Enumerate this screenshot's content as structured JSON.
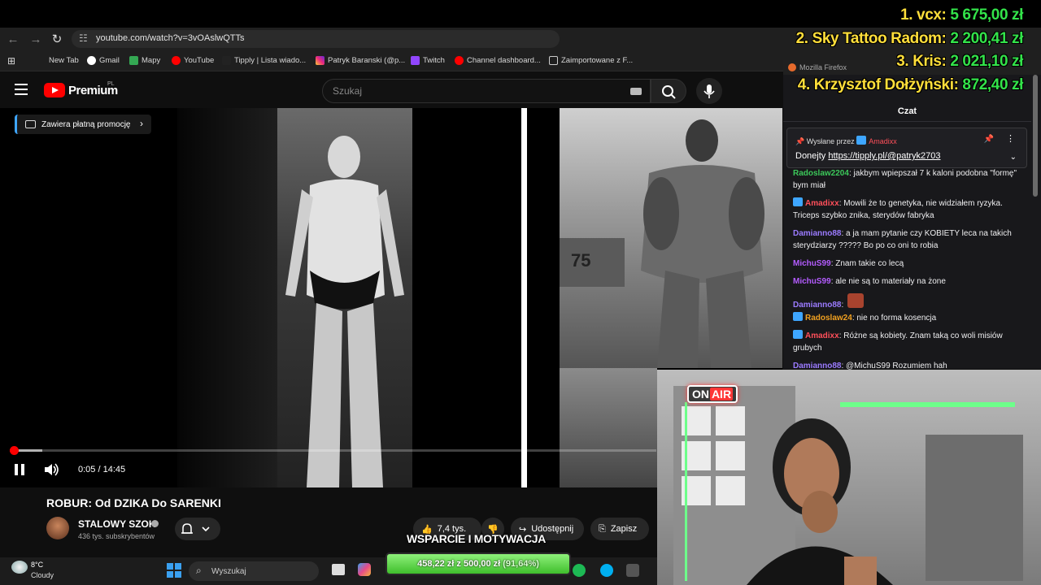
{
  "browser": {
    "url": "youtube.com/watch?v=3vOAslwQTTs",
    "bookmarks": [
      "New Tab",
      "Gmail",
      "Mapy",
      "YouTube",
      "Tipply | Lista wiado...",
      "Patryk Baranski (@p...",
      "Twitch",
      "Channel dashboard...",
      "Zaimportowane z F..."
    ]
  },
  "youtube": {
    "logo_text": "Premium",
    "region": "PL",
    "search_placeholder": "Szukaj",
    "promo_label": "Zawiera płatną promocję",
    "time_display": "0:05 / 14:45",
    "progress_fraction": 0.006,
    "buffered_fraction": 0.05,
    "video_title": "ROBUR: Od DZIKA Do SARENKI",
    "channel_name": "STALOWY SZOK",
    "channel_subs": "436 tys. subskrybentów",
    "likes": "7,4 tys.",
    "share_label": "Udostępnij",
    "save_label": "Zapisz"
  },
  "leaderboard": [
    {
      "rank": "1.",
      "name": "vcx:",
      "amount": "5 675,00 zł"
    },
    {
      "rank": "2.",
      "name": "Sky Tattoo Radom:",
      "amount": "2 200,41 zł"
    },
    {
      "rank": "3.",
      "name": "Kris:",
      "amount": "2 021,10 zł"
    },
    {
      "rank": "4.",
      "name": "Krzysztof Dołżyński:",
      "amount": "872,40 zł"
    }
  ],
  "chat": {
    "window_title": "Mozilla Firefox",
    "header": "Czat",
    "pinned_by_label": "Wysłane przez",
    "pinned_user": "Amadixx",
    "pinned_text": "Donejty ",
    "pinned_link": "https://tipply.pl/@patryk2703",
    "messages": [
      {
        "user": "Radoslaw2204",
        "color": "#3cc85a",
        "text": "jakbym wpiepszał 7 k kaloni podobna \"formę\" bym miał"
      },
      {
        "user": "Amadixx",
        "color": "#ff4f5a",
        "text": "Mowili że to genetyka, nie widziałem ryzyka. Triceps szybko znika, sterydów fabryka"
      },
      {
        "user": "Damianno88",
        "color": "#9b7bff",
        "text": "a ja mam pytanie czy KOBIETY leca na takich sterydziarzy ????? Bo po co oni to robia"
      },
      {
        "user": "MichuS99",
        "color": "#b45cff",
        "text": "Znam takie co lecą"
      },
      {
        "user": "MichuS99",
        "color": "#b45cff",
        "text": "ale nie są to materiały na żone"
      },
      {
        "user": "Damianno88",
        "color": "#9b7bff",
        "text": ""
      },
      {
        "user": "Radoslaw24",
        "color": "#f0a020",
        "text": "nie no forma kosencja"
      },
      {
        "user": "Amadixx",
        "color": "#ff4f5a",
        "text": "Różne są kobiety. Znam taką co woli misiów grubych"
      },
      {
        "user": "Damianno88",
        "color": "#9b7bff",
        "text": "@MichuS99 Rozumiem hah"
      }
    ]
  },
  "goal": {
    "title": "WSPARCIE I MOTYWACJA",
    "current": "458,22 zł",
    "separator": "z",
    "target": "500,00 zł",
    "percent": "(91,64%)"
  },
  "taskbar": {
    "temperature": "8°C",
    "weather": "Cloudy",
    "search_placeholder": "Wyszukaj"
  },
  "webcam": {
    "sign_on": "ON",
    "sign_air": "AIR"
  }
}
